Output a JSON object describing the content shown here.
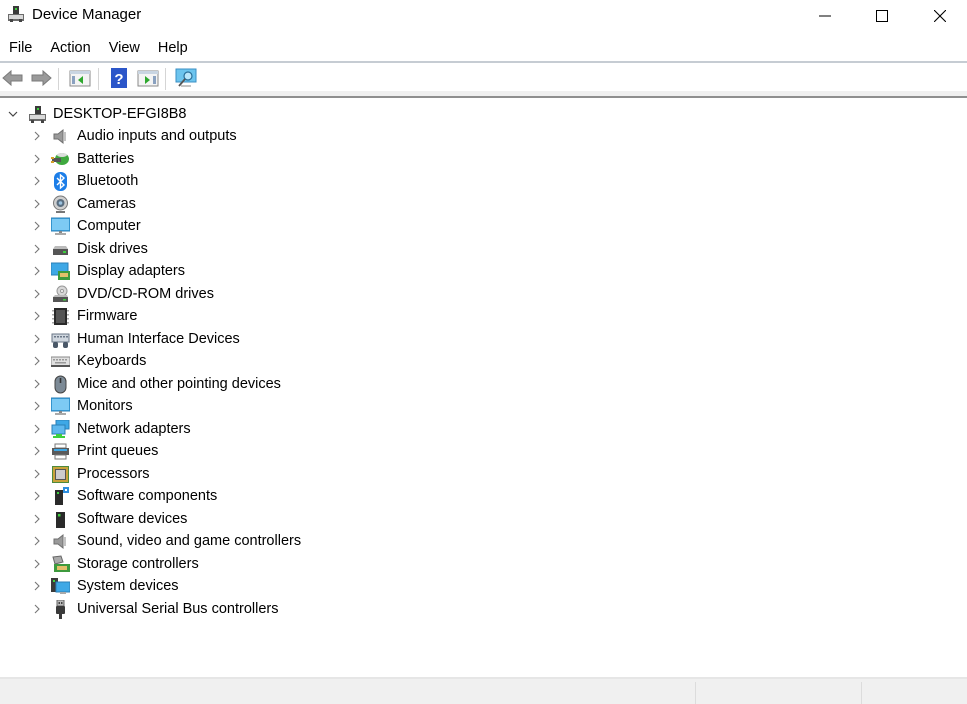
{
  "window": {
    "title": "Device Manager",
    "app_icon": "device-manager-icon",
    "controls": {
      "minimize": "minimize-icon",
      "maximize": "maximize-icon",
      "close": "close-icon"
    }
  },
  "menubar": {
    "items": [
      {
        "label": "File"
      },
      {
        "label": "Action"
      },
      {
        "label": "View"
      },
      {
        "label": "Help"
      }
    ]
  },
  "toolbar": {
    "buttons": [
      {
        "icon": "back-arrow-icon",
        "tooltip": "Back"
      },
      {
        "icon": "forward-arrow-icon",
        "tooltip": "Forward"
      },
      {
        "icon": "show-hide-console-tree-icon",
        "tooltip": "Show/Hide Console Tree"
      },
      {
        "icon": "help-icon",
        "tooltip": "Help"
      },
      {
        "icon": "show-hide-action-pane-icon",
        "tooltip": "Show/Hide Action Pane"
      },
      {
        "icon": "scan-hardware-icon",
        "tooltip": "Scan for hardware changes"
      }
    ]
  },
  "tree": {
    "root": {
      "label": "DESKTOP-EFGI8B8",
      "expanded": true,
      "icon": "computer-tower-icon"
    },
    "categories": [
      {
        "label": "Audio inputs and outputs",
        "icon": "speaker-icon"
      },
      {
        "label": "Batteries",
        "icon": "battery-icon"
      },
      {
        "label": "Bluetooth",
        "icon": "bluetooth-icon"
      },
      {
        "label": "Cameras",
        "icon": "camera-icon"
      },
      {
        "label": "Computer",
        "icon": "monitor-icon"
      },
      {
        "label": "Disk drives",
        "icon": "disk-drive-icon"
      },
      {
        "label": "Display adapters",
        "icon": "display-adapter-icon"
      },
      {
        "label": "DVD/CD-ROM drives",
        "icon": "dvd-drive-icon"
      },
      {
        "label": "Firmware",
        "icon": "firmware-chip-icon"
      },
      {
        "label": "Human Interface Devices",
        "icon": "hid-icon"
      },
      {
        "label": "Keyboards",
        "icon": "keyboard-icon"
      },
      {
        "label": "Mice and other pointing devices",
        "icon": "mouse-icon"
      },
      {
        "label": "Monitors",
        "icon": "monitor-icon"
      },
      {
        "label": "Network adapters",
        "icon": "network-adapter-icon"
      },
      {
        "label": "Print queues",
        "icon": "printer-icon"
      },
      {
        "label": "Processors",
        "icon": "processor-icon"
      },
      {
        "label": "Software components",
        "icon": "software-component-icon"
      },
      {
        "label": "Software devices",
        "icon": "software-device-icon"
      },
      {
        "label": "Sound, video and game controllers",
        "icon": "speaker-icon"
      },
      {
        "label": "Storage controllers",
        "icon": "storage-controller-icon"
      },
      {
        "label": "System devices",
        "icon": "system-devices-icon"
      },
      {
        "label": "Universal Serial Bus controllers",
        "icon": "usb-icon"
      }
    ]
  },
  "statusbar": {
    "panes": [
      "",
      "",
      ""
    ]
  }
}
